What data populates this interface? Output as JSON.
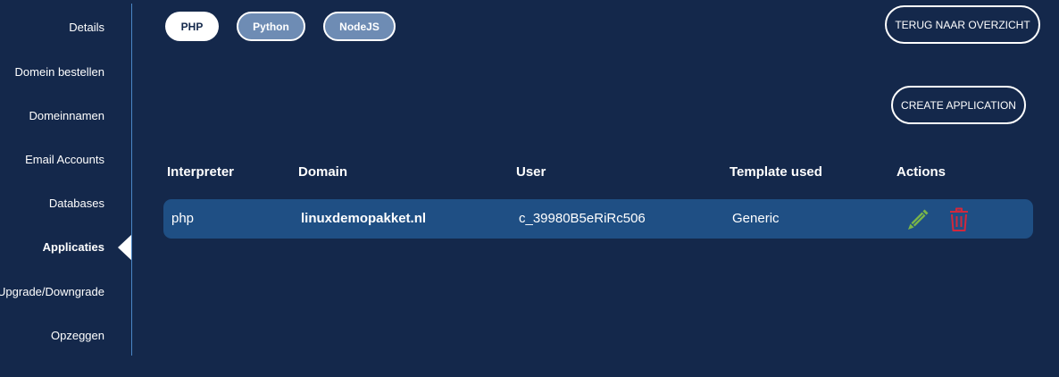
{
  "sidebar": {
    "items": [
      {
        "label": "Details"
      },
      {
        "label": "Domein bestellen"
      },
      {
        "label": "Domeinnamen"
      },
      {
        "label": "Email Accounts"
      },
      {
        "label": "Databases"
      },
      {
        "label": "Applicaties",
        "active": true
      },
      {
        "label": "Upgrade/Downgrade"
      },
      {
        "label": "Opzeggen"
      }
    ]
  },
  "tabs": [
    {
      "label": "PHP",
      "active": true
    },
    {
      "label": "Python",
      "active": false
    },
    {
      "label": "NodeJS",
      "active": false
    }
  ],
  "buttons": {
    "back_label": "TERUG NAAR OVERZICHT",
    "create_label": "CREATE APPLICATION"
  },
  "table": {
    "headers": [
      "Interpreter",
      "Domain",
      "User",
      "Template used",
      "Actions"
    ],
    "rows": [
      {
        "interpreter": "php",
        "domain": "linuxdemopakket.nl",
        "user": "c_39980B5eRiRc506",
        "template": "Generic",
        "actions": [
          "pencil-icon",
          "trash-icon"
        ]
      }
    ]
  },
  "colors": {
    "background": "#14284b",
    "row_background": "#1f4f84",
    "edit_icon": "#7ab648",
    "delete_icon": "#d2283c",
    "tab_inactive": "#6e8cb4"
  }
}
